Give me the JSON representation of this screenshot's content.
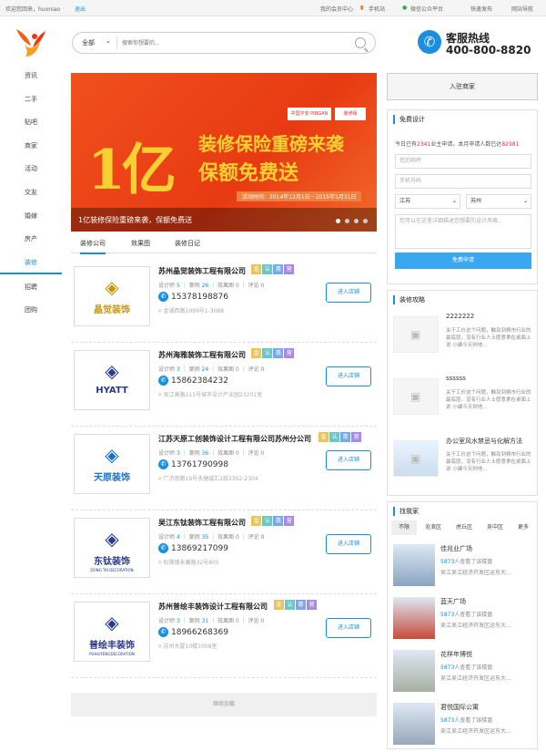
{
  "topbar": {
    "welcome": "欢迎您回来，huoniao",
    "logout": "退出",
    "member": "我的会员中心",
    "mobile": "手机站",
    "wechat": "微信公众平台",
    "publish": "快速发布",
    "sitemap": "网站导航"
  },
  "search": {
    "category": "全部",
    "placeholder": "搜索你想要的..."
  },
  "hotline": {
    "title": "客服热线",
    "number": "400-800-8820"
  },
  "nav": [
    "资讯",
    "二手",
    "贴吧",
    "商家",
    "活动",
    "交友",
    "婚嫁",
    "房产",
    "装修",
    "招聘",
    "团购"
  ],
  "banner": {
    "brand1": "中国平安 PINGAN",
    "brand2": "装修保",
    "big": "1亿",
    "line1": "装修保险重磅来袭",
    "line2": "保额免费送",
    "date": "活动时间：2014年12月1日－2015年1月31日",
    "caption": "1亿装修保险重磅来袭，保额免费送"
  },
  "tabs": [
    "装修公司",
    "效果图",
    "装修日记"
  ],
  "labels": {
    "designer": "设计师",
    "case": "案例",
    "rendering": "效果图",
    "review": "评论",
    "enter": "进入店铺",
    "load_more": "继续加载"
  },
  "badge_chars": [
    "金",
    "认",
    "惠",
    "营"
  ],
  "companies": [
    {
      "name": "苏州晶觉装饰工程有限公司",
      "designers": "5",
      "cases": "26",
      "renderings": "0",
      "reviews": "0",
      "phone": "15378198876",
      "address": "金湖西路1099号1-3088",
      "logo_text": "晶觉装饰",
      "logo_sub": ""
    },
    {
      "name": "苏州海雅装饰工程有限公司",
      "designers": "3",
      "cases": "24",
      "renderings": "0",
      "reviews": "0",
      "phone": "15862384232",
      "address": "吴江高路211号城市设计产业园23201室",
      "logo_text": "HYATT",
      "logo_sub": ""
    },
    {
      "name": "江苏天原工创装饰设计工程有限公司苏州分公司",
      "designers": "3",
      "cases": "36",
      "renderings": "0",
      "reviews": "0",
      "phone": "13761790998",
      "address": "广济南路19号永捷威汇2层2302-2304",
      "logo_text": "天原装饰",
      "logo_sub": ""
    },
    {
      "name": "吴江东钛装饰工程有限公司",
      "designers": "4",
      "cases": "35",
      "renderings": "0",
      "reviews": "0",
      "phone": "13869217099",
      "address": "松陵镇永康路32号805",
      "logo_text": "东钛装饰",
      "logo_sub": "DONG TAI DECORATION"
    },
    {
      "name": "苏州普绘丰装饰设计工程有限公司",
      "designers": "3",
      "cases": "31",
      "renderings": "0",
      "reviews": "0",
      "phone": "18966268369",
      "address": "苏州大厦10楼1008室",
      "logo_text": "普绘丰装饰",
      "logo_sub": "PUHUIFENGDECORATION"
    }
  ],
  "right": {
    "join": "入驻商家",
    "design": {
      "title": "免费设计",
      "today_pre": "今日已有",
      "today_num": "2341",
      "today_mid": "业主申请，本月申请人数已达",
      "month_num": "82981",
      "name_ph": "您的称呼",
      "phone_ph": "手机号码",
      "province": "江苏",
      "city": "苏州",
      "note_ph": "您可以在这里详细描述您想要的设计风格...",
      "submit": "免费申请"
    },
    "tips": {
      "title": "装修攻略",
      "items": [
        {
          "title": "2222222",
          "text": "关于工价这个问题，触及到俩市行业的最底层，没有行业人士愿意拿在桌面上说 小编今天则地..."
        },
        {
          "title": "ssssss",
          "text": "关于工价这个问题，触及到俩市行业的最底层，没有行业人士愿意拿在桌面上说 小编今天则地..."
        },
        {
          "title": "办公室风水禁忌与化解方法",
          "text": "关于工价这个问题，触及到俩市行业的最底层，没有行业人士愿意拿在桌面上说 小编今天则地..."
        }
      ]
    },
    "buildings": {
      "title": "找我家",
      "tabs": [
        "不限",
        "沧浪区",
        "虎丘区",
        "吴中区",
        "更多"
      ],
      "count_suffix": "人查看了该楼盘",
      "items": [
        {
          "name": "佳兆业广场",
          "count": "5873",
          "address": "吴江吴江经济开发区运东大..."
        },
        {
          "name": "蓝天广场",
          "count": "5873",
          "address": "吴江吴江经济开发区运东大..."
        },
        {
          "name": "花样年博悦",
          "count": "5873",
          "address": "吴江吴江经济开发区运东大..."
        },
        {
          "name": "君悦国际公寓",
          "count": "5873",
          "address": "吴江吴江经济开发区运东大..."
        }
      ]
    }
  },
  "colors": {
    "accent": "#1a8fe0",
    "banner": "#e84a1c",
    "gold": "#f7d034"
  }
}
